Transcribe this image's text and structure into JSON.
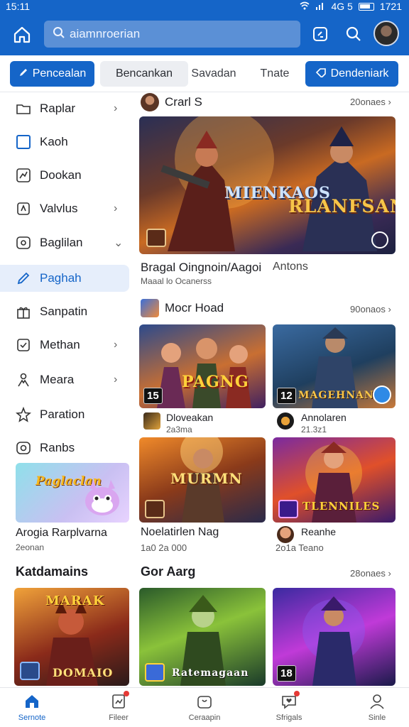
{
  "status_bar": {
    "time": "15:11",
    "net": "4G 5",
    "clock": "1721"
  },
  "header": {
    "search_text": "aiamnroerian"
  },
  "chips": [
    {
      "label": "Pencealan"
    },
    {
      "label": "Bencankan"
    },
    {
      "label": "Savadan"
    },
    {
      "label": "Tnate"
    },
    {
      "label": "Dendeniark"
    }
  ],
  "sidebar": {
    "items": [
      {
        "label": "Raplar"
      },
      {
        "label": "Kaoh"
      },
      {
        "label": "Dookan"
      },
      {
        "label": "Valvlus"
      },
      {
        "label": "Baglilan"
      },
      {
        "label": "Paghah"
      },
      {
        "label": "Sanpatin"
      },
      {
        "label": "Methan"
      },
      {
        "label": "Meara"
      },
      {
        "label": "Paration"
      },
      {
        "label": "Ranbs"
      }
    ],
    "promo": {
      "title": "Arogia Rarplvarna",
      "sub": "2eonan",
      "art_text": "Paglaclan"
    },
    "bottom_heading": "Katdamains"
  },
  "main": {
    "section1": {
      "title": "Crarl S",
      "more": "20onaes"
    },
    "hero": {
      "art_text_1": "MIENKAOS",
      "art_text_2": "RLANFSAN",
      "caption": "Bragal Oingnoin/Aagoi",
      "caption_right": "Antons",
      "sub": "Maaal lo Ocanerss"
    },
    "section2": {
      "title": "Mocr Hoad",
      "more": "90onaos"
    },
    "cards": [
      {
        "art": "PAGNG",
        "num": "15",
        "title": "Dloveakan",
        "sub": "2a3ma"
      },
      {
        "art": "MAGEHNAN",
        "num": "12",
        "title": "Annolaren",
        "sub": "21.3z1"
      },
      {
        "art": "MURMN",
        "title": "Noelatirlen Nag",
        "sub": "1a0 2a 000"
      },
      {
        "art": "TLENNILES",
        "title": "Reanhe",
        "sub": "2o1a Teano"
      }
    ],
    "section3": {
      "title": "Gor Aarg",
      "more": "28onaes"
    },
    "bottom_cards": [
      {
        "art": "MARAK",
        "art2": "DOMAIO"
      },
      {
        "art": "Ratemagaan"
      },
      {
        "num": "18"
      }
    ]
  },
  "bottom_nav": [
    {
      "label": "Sernote"
    },
    {
      "label": "Fileer"
    },
    {
      "label": "Ceraapin"
    },
    {
      "label": "Sfrigals"
    },
    {
      "label": "Sinle"
    }
  ],
  "colors": {
    "brand": "#1565c8",
    "active_bg": "#e6eefb"
  }
}
